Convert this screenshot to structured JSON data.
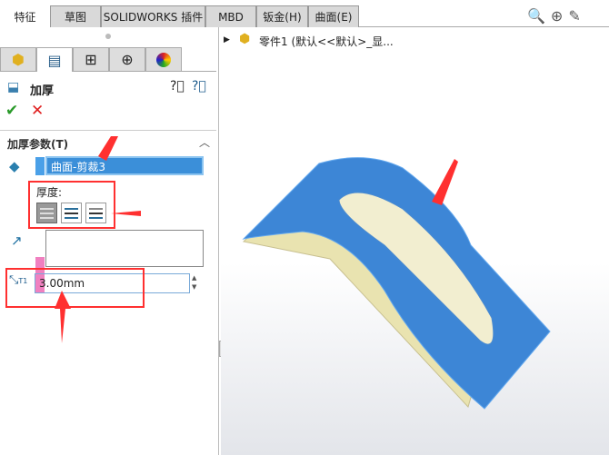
{
  "tabs": [
    "特征",
    "草图",
    "SOLIDWORKS 插件",
    "MBD",
    "钣金(H)",
    "曲面(E)"
  ],
  "feature_tree": {
    "part": "零件1  (默认<<默认>_显..."
  },
  "panel": {
    "title": "加厚",
    "section": "加厚参数(T)",
    "surface": "曲面-剪裁3",
    "thickness_label": "厚度:",
    "thickness_value": "3.00mm",
    "thickness_icon_label": "T1"
  },
  "colors": {
    "accent": "#3b8fd9",
    "highlight": "#ff3030"
  }
}
